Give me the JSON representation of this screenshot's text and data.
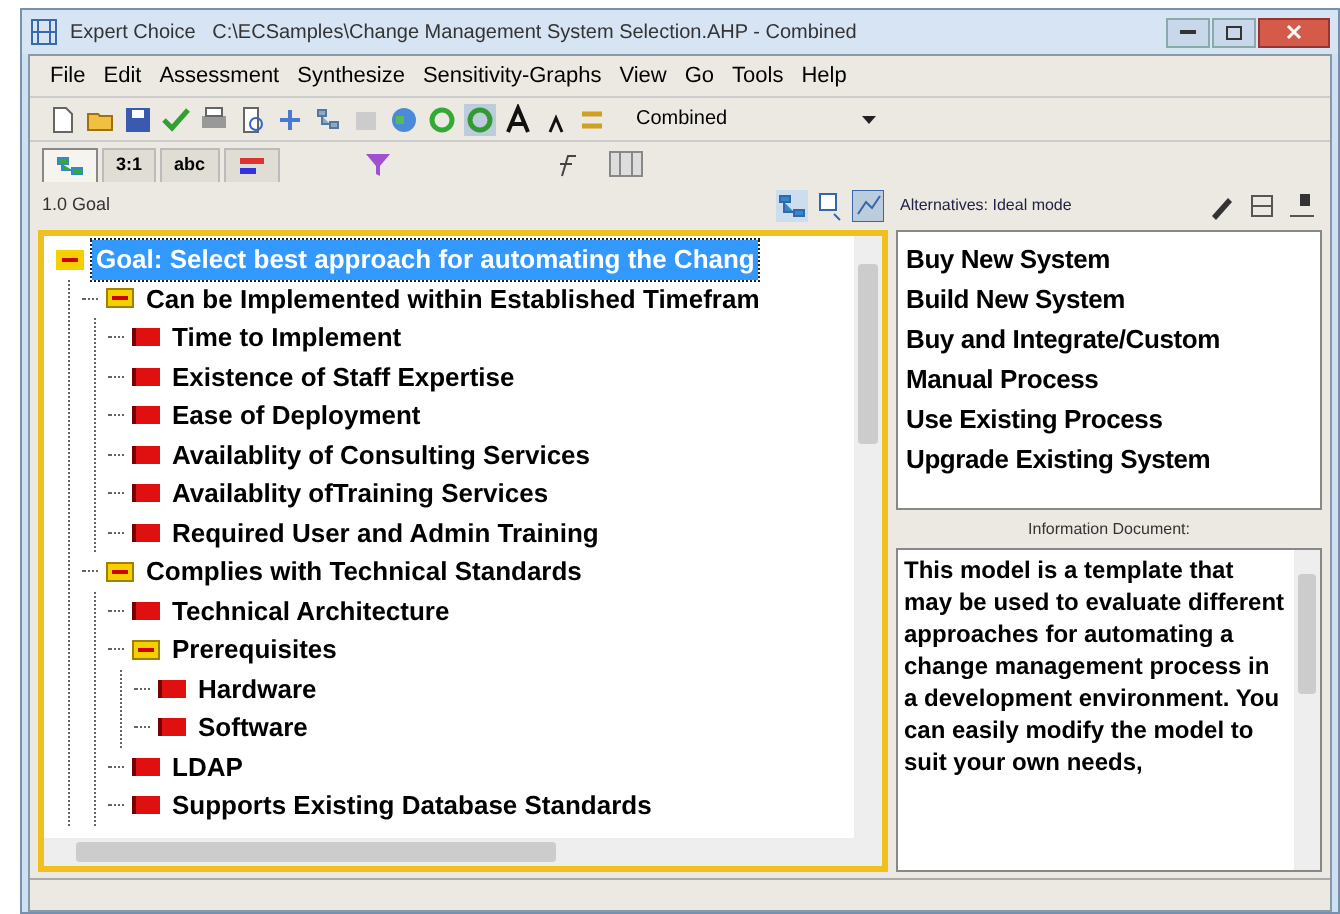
{
  "window": {
    "title": "Expert Choice   C:\\ECSamples\\Change Management System Selection.AHP - Combined"
  },
  "menu": [
    "File",
    "Edit",
    "Assessment",
    "Synthesize",
    "Sensitivity-Graphs",
    "View",
    "Go",
    "Tools",
    "Help"
  ],
  "toolbar": {
    "mode_select": {
      "value": "Combined"
    }
  },
  "tabs": [
    {
      "kind": "icon",
      "selected": true
    },
    {
      "kind": "text",
      "label": "3:1",
      "selected": false
    },
    {
      "kind": "text",
      "label": "abc",
      "selected": false
    },
    {
      "kind": "icon",
      "selected": false
    }
  ],
  "tree_pane": {
    "header": "1.0 Goal",
    "tree": [
      {
        "label": "Goal: Select best approach for automating the Chang",
        "selected": true,
        "expanded": true,
        "children": [
          {
            "label": "Can be Implemented within Established Timefram",
            "selected": false,
            "expanded": true,
            "children": [
              {
                "label": "Time to Implement",
                "selected": false
              },
              {
                "label": "Existence of Staff Expertise",
                "selected": false
              },
              {
                "label": "Ease of Deployment",
                "selected": false
              },
              {
                "label": "Availablity of Consulting Services",
                "selected": false
              },
              {
                "label": "Availablity ofTraining Services",
                "selected": false
              },
              {
                "label": "Required User and Admin Training",
                "selected": false
              }
            ]
          },
          {
            "label": "Complies with Technical Standards",
            "selected": false,
            "expanded": true,
            "children": [
              {
                "label": "Technical Architecture",
                "selected": false
              },
              {
                "label": "Prerequisites",
                "selected": false,
                "expanded": true,
                "children": [
                  {
                    "label": "Hardware",
                    "selected": false
                  },
                  {
                    "label": "Software",
                    "selected": false
                  }
                ]
              },
              {
                "label": "LDAP",
                "selected": false
              },
              {
                "label": "Supports Existing Database Standards",
                "selected": false
              }
            ]
          }
        ]
      }
    ]
  },
  "alternatives_pane": {
    "header": "Alternatives: Ideal mode",
    "alternatives": [
      "Buy New System",
      "Build New System",
      "Buy and Integrate/Custom",
      "Manual Process",
      "Use Existing Process",
      "Upgrade Existing System"
    ]
  },
  "information_document": {
    "label": "Information Document:",
    "text": "This model is a template that may be used to evaluate different approaches for automating a change management process in a development environment. You can easily modify the model to suit your own needs,"
  }
}
